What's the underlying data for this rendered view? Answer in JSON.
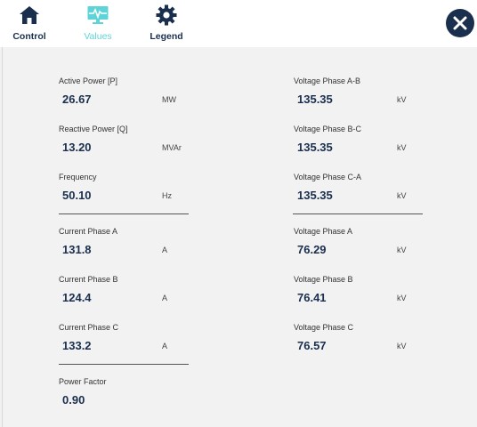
{
  "toolbar": {
    "tabs": [
      {
        "label": "Control",
        "icon": "home-icon",
        "active": false
      },
      {
        "label": "Values",
        "icon": "monitor-pulse-icon",
        "active": true
      },
      {
        "label": "Legend",
        "icon": "gear-icon",
        "active": false
      }
    ],
    "close_icon": "close-icon"
  },
  "colors": {
    "navy": "#1a2f4e",
    "active_tab": "#5fd4d8",
    "background": "#f2f2f2"
  },
  "left_column": [
    {
      "label": "Active Power [P]",
      "value": "26.67",
      "unit": "MW"
    },
    {
      "label": "Reactive Power [Q]",
      "value": "13.20",
      "unit": "MVAr"
    },
    {
      "label": "Frequency",
      "value": "50.10",
      "unit": "Hz"
    },
    {
      "label": "Current Phase A",
      "value": "131.8",
      "unit": "A"
    },
    {
      "label": "Current Phase B",
      "value": "124.4",
      "unit": "A"
    },
    {
      "label": "Current Phase C",
      "value": "133.2",
      "unit": "A"
    },
    {
      "label": "Power Factor",
      "value": "0.90",
      "unit": ""
    }
  ],
  "right_column": [
    {
      "label": "Voltage Phase A-B",
      "value": "135.35",
      "unit": "kV"
    },
    {
      "label": "Voltage Phase B-C",
      "value": "135.35",
      "unit": "kV"
    },
    {
      "label": "Voltage Phase C-A",
      "value": "135.35",
      "unit": "kV"
    },
    {
      "label": "Voltage Phase A",
      "value": "76.29",
      "unit": "kV"
    },
    {
      "label": "Voltage Phase B",
      "value": "76.41",
      "unit": "kV"
    },
    {
      "label": "Voltage Phase C",
      "value": "76.57",
      "unit": "kV"
    }
  ]
}
